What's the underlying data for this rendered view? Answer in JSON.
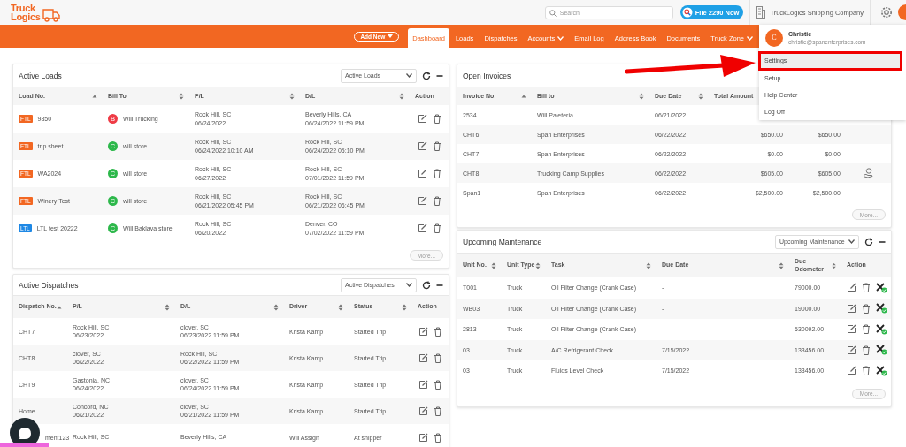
{
  "header": {
    "logo": [
      "Truck",
      "Logics"
    ],
    "search": {
      "placeholder": "Search"
    },
    "file_button": "File 2290 Now",
    "company": "TruckLogics Shipping Company"
  },
  "nav": {
    "add_new": "Add New",
    "tabs": [
      {
        "label": "Dashboard",
        "selected": true,
        "has_menu": false
      },
      {
        "label": "Loads",
        "selected": false,
        "has_menu": false
      },
      {
        "label": "Dispatches",
        "selected": false,
        "has_menu": false
      },
      {
        "label": "Accounts",
        "selected": false,
        "has_menu": true
      },
      {
        "label": "Email Log",
        "selected": false,
        "has_menu": false
      },
      {
        "label": "Address Book",
        "selected": false,
        "has_menu": false
      },
      {
        "label": "Documents",
        "selected": false,
        "has_menu": false
      },
      {
        "label": "Truck Zone",
        "selected": false,
        "has_menu": true
      }
    ]
  },
  "left": [
    {
      "kind": "loads",
      "title": "Active Loads",
      "select": "Active Loads",
      "more": "More...",
      "columns": [
        {
          "label": "Load No.",
          "sortable": true,
          "sort_ascending": true
        },
        {
          "label": "Bill To",
          "sortable": true,
          "sort_ascending": false
        },
        {
          "label": "P/L",
          "sortable": true,
          "sort_ascending": false
        },
        {
          "label": "D/L",
          "sortable": true,
          "sort_ascending": false
        },
        {
          "label": "Action",
          "sortable": false
        }
      ],
      "rows": [
        {
          "badge": {
            "text": "FTL",
            "color": "#f26722"
          },
          "load_no": "9850",
          "bill_to": {
            "initial": "B",
            "color": "#ef3b45",
            "name": "Will Trucking"
          },
          "pl": [
            "Rock Hill, SC",
            "06/24/2022"
          ],
          "dl": [
            "Beverly Hills, CA",
            "06/24/2022 11:59 PM"
          ]
        },
        {
          "badge": {
            "text": "FTL",
            "color": "#f26722"
          },
          "load_no": "trip sheet",
          "bill_to": {
            "initial": "C",
            "color": "#2db84b",
            "name": "will store"
          },
          "pl": [
            "Rock Hill, SC",
            "06/24/2022 10:10 AM"
          ],
          "dl": [
            "Rock Hill, SC",
            "06/24/2022 05:10 PM"
          ]
        },
        {
          "badge": {
            "text": "FTL",
            "color": "#f26722"
          },
          "load_no": "WA2024",
          "bill_to": {
            "initial": "C",
            "color": "#2db84b",
            "name": "will store"
          },
          "pl": [
            "Rock Hill, SC",
            "06/27/2022"
          ],
          "dl": [
            "Rock Hill, SC",
            "07/01/2022 11:59 PM"
          ]
        },
        {
          "badge": {
            "text": "FTL",
            "color": "#f26722"
          },
          "load_no": "Winery Test",
          "bill_to": {
            "initial": "C",
            "color": "#2db84b",
            "name": "will store"
          },
          "pl": [
            "Rock Hill, SC",
            "06/21/2022 05:45 PM"
          ],
          "dl": [
            "Rock Hill, SC",
            "06/21/2022 06:45 PM"
          ]
        },
        {
          "badge": {
            "text": "LTL",
            "color": "#1e88e5"
          },
          "load_no": "LTL test 20222",
          "bill_to": {
            "initial": "C",
            "color": "#2db84b",
            "name": "Will Baklava store"
          },
          "pl": [
            "Rock Hill, SC",
            "06/20/2022"
          ],
          "dl": [
            "Denver, CO",
            "07/02/2022 11:59 PM"
          ]
        }
      ]
    },
    {
      "kind": "dispatches",
      "title": "Active Dispatches",
      "select": "Active Dispatches",
      "columns": [
        {
          "label": "Dispatch No.",
          "sortable": true,
          "sort_ascending": true
        },
        {
          "label": "P/L",
          "sortable": true,
          "sort_ascending": false
        },
        {
          "label": "D/L",
          "sortable": true,
          "sort_ascending": false
        },
        {
          "label": "Driver",
          "sortable": true,
          "sort_ascending": false
        },
        {
          "label": "Status",
          "sortable": true,
          "sort_ascending": false
        },
        {
          "label": "Action",
          "sortable": false
        }
      ],
      "rows": [
        {
          "dispatch_no": "CHT7",
          "pl": [
            "Rock Hill, SC",
            "06/23/2022"
          ],
          "dl": [
            "clover, SC",
            "06/23/2022 11:59 PM"
          ],
          "driver": "Krista Kamp",
          "status": "Started Trip"
        },
        {
          "dispatch_no": "CHT8",
          "pl": [
            "clover, SC",
            "06/22/2022"
          ],
          "dl": [
            "Rock Hill, SC",
            "06/22/2022 11:59 PM"
          ],
          "driver": "Krista Kamp",
          "status": "Started Trip"
        },
        {
          "dispatch_no": "CHT9",
          "pl": [
            "Gastonia, NC",
            "06/24/2022"
          ],
          "dl": [
            "clover, SC",
            "06/24/2022 11:59 PM"
          ],
          "driver": "Krista Kamp",
          "status": "Started Trip"
        },
        {
          "dispatch_no": "Home",
          "pl": [
            "Concord, NC",
            "06/21/2022"
          ],
          "dl": [
            "clover, SC",
            "06/21/2022 11:59 PM"
          ],
          "driver": "Krista Kamp",
          "status": "Started Trip"
        },
        {
          "dispatch_no": "ment123",
          "under_chat": true,
          "pl": [
            "Rock Hill, SC"
          ],
          "dl": [
            "Beverly Hills, CA"
          ],
          "driver": "Will Assign",
          "status": "At shipper"
        }
      ]
    }
  ],
  "right": [
    {
      "kind": "invoices",
      "title": "Open Invoices",
      "more": "More...",
      "columns": [
        {
          "label": "Invoice No.",
          "sortable": true,
          "sort_ascending": true
        },
        {
          "label": "Bill to",
          "sortable": true,
          "sort_ascending": false
        },
        {
          "label": "Due Date",
          "sortable": true,
          "sort_ascending": false
        },
        {
          "label": "Total Amount"
        }
      ],
      "rows": [
        {
          "invoice_no": "2534",
          "bill_to": "Will Paleteria",
          "due_date": "06/21/2022"
        },
        {
          "invoice_no": "CHT6",
          "bill_to": "Span Enterprises",
          "due_date": "06/22/2022",
          "total": "$650.00",
          "column_5": "$650.00",
          "pay": false
        },
        {
          "invoice_no": "CHT7",
          "bill_to": "Span Enterprises",
          "due_date": "06/22/2022",
          "total": "$0.00",
          "column_5": "$0.00",
          "pay": false
        },
        {
          "invoice_no": "CHT8",
          "bill_to": "Trucking Camp Supplies",
          "due_date": "06/22/2022",
          "total": "$605.00",
          "column_5": "$605.00",
          "pay": true
        },
        {
          "invoice_no": "Span1",
          "bill_to": "Span Enterprises",
          "due_date": "06/22/2022",
          "total": "$2,500.00",
          "column_5": "$2,500.00",
          "pay": false
        }
      ]
    },
    {
      "kind": "maintenance",
      "title": "Upcoming Maintenance",
      "select": "Upcoming Maintenance",
      "more": "More...",
      "columns": [
        {
          "label": "Unit No.",
          "sortable": true,
          "sort_ascending": false
        },
        {
          "label": "Unit Type",
          "sortable": true,
          "sort_ascending": false
        },
        {
          "label": "Task",
          "sortable": true,
          "sort_ascending": false
        },
        {
          "label": "Due Date",
          "sortable": true,
          "sort_ascending": false
        },
        {
          "label": "Due Odometer",
          "sortable": true,
          "sort_ascending": false
        },
        {
          "label": "Action",
          "sortable": false
        }
      ],
      "rows": [
        {
          "unit_no": "T001",
          "unit_type": "Truck",
          "task": "Oil Filter Change (Crank Case)",
          "due_date": "-",
          "due_odometer": "79000.00"
        },
        {
          "unit_no": "WB03",
          "unit_type": "Truck",
          "task": "Oil Filter Change (Crank Case)",
          "due_date": "-",
          "due_odometer": "19000.00"
        },
        {
          "unit_no": "2813",
          "unit_type": "Truck",
          "task": "Oil Filter Change (Crank Case)",
          "due_date": "-",
          "due_odometer": "530092.00"
        },
        {
          "unit_no": "03",
          "unit_type": "Truck",
          "task": "A/C Refrigerant Check",
          "due_date": "7/15/2022",
          "due_odometer": "133456.00"
        },
        {
          "unit_no": "03",
          "unit_type": "Truck",
          "task": "Fluids Level Check",
          "due_date": "7/15/2022",
          "due_odometer": "133456.00"
        }
      ]
    }
  ],
  "user_menu": {
    "avatar": "C",
    "name": "Christie",
    "email": "christie@spanenterprises.com",
    "items": [
      {
        "label": "Settings",
        "highlighted": true
      },
      {
        "label": "Setup",
        "highlighted": false
      },
      {
        "label": "Help Center",
        "highlighted": false
      },
      {
        "label": "Log Off",
        "highlighted": false
      }
    ]
  }
}
